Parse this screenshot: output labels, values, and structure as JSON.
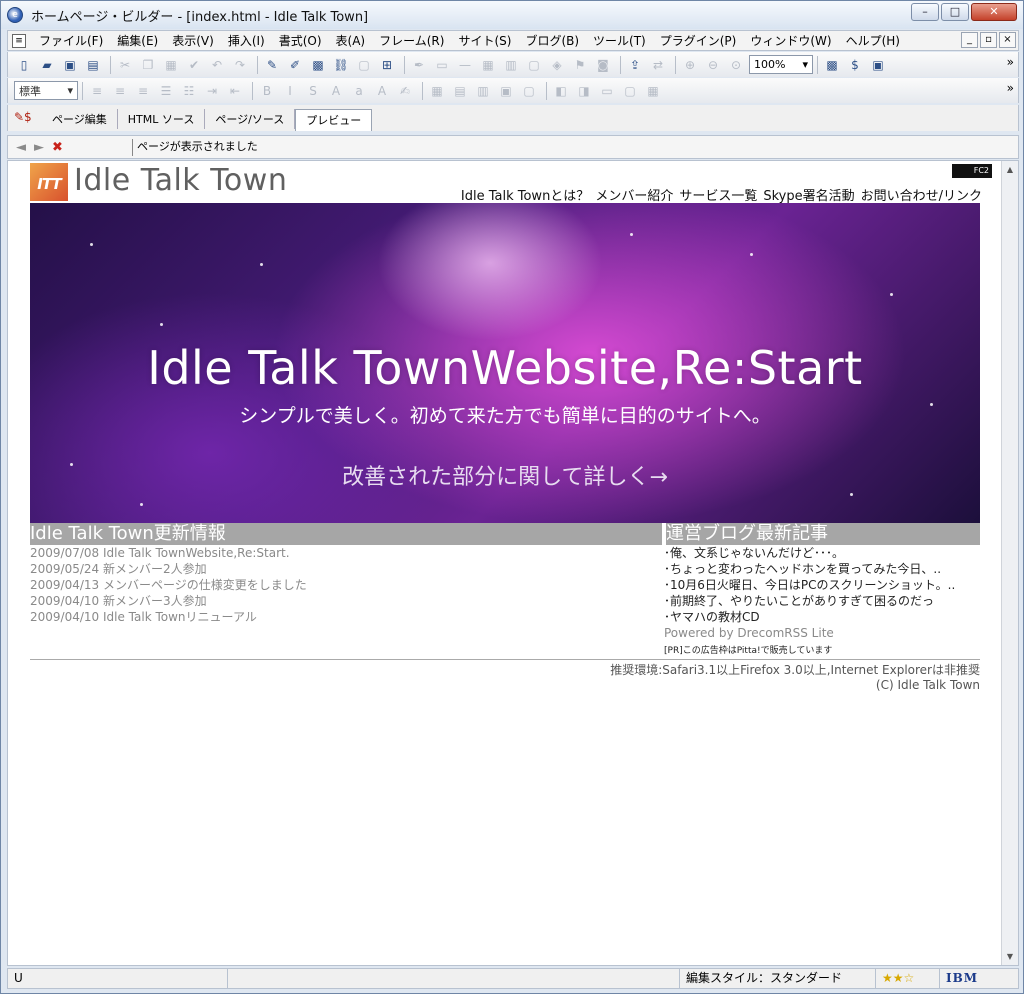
{
  "window": {
    "title": "ホームページ・ビルダー - [index.html - Idle Talk Town]",
    "buttons": {
      "minimize": "–",
      "maximize": "□",
      "close": "✕"
    }
  },
  "menubar": {
    "items": [
      "ファイル(F)",
      "編集(E)",
      "表示(V)",
      "挿入(I)",
      "書式(O)",
      "表(A)",
      "フレーム(R)",
      "サイト(S)",
      "ブログ(B)",
      "ツール(T)",
      "プラグイン(P)",
      "ウィンドウ(W)",
      "ヘルプ(H)"
    ],
    "mdi": {
      "minimize": "_",
      "restore": "▫",
      "close": "×"
    }
  },
  "toolbar": {
    "zoom": "100%",
    "style_select": "標準",
    "more": "»"
  },
  "tabs": {
    "items": [
      "ページ編集",
      "HTML ソース",
      "ページ/ソース",
      "プレビュー"
    ],
    "active_index": 3
  },
  "nav": {
    "back": "◄",
    "forward": "►",
    "stop": "✖",
    "status_message": "ページが表示されました"
  },
  "site": {
    "badge": "FC2",
    "logo_mark": "ITT",
    "logo_text": "Idle Talk Town",
    "nav": [
      "Idle Talk Townとは？",
      "メンバー紹介",
      "サービス一覧",
      "Skype署名活動",
      "お問い合わせ/リンク"
    ],
    "hero": {
      "title": "Idle Talk TownWebsite,Re:Start",
      "subtitle": "シンプルで美しく。初めて来た方でも簡単に目的のサイトへ。",
      "link": "改善された部分に関して詳しく→"
    },
    "news": {
      "heading": "Idle Talk Town更新情報",
      "items": [
        "2009/07/08 Idle Talk TownWebsite,Re:Start.",
        "2009/05/24 新メンバー2人参加",
        "2009/04/13 メンバーページの仕様変更をしました",
        "2009/04/10 新メンバー3人参加",
        "2009/04/10 Idle Talk Townリニューアル"
      ]
    },
    "blog": {
      "heading": "運営ブログ最新記事",
      "items": [
        "･俺、文系じゃないんだけど･･･。",
        "･ちょっと変わったヘッドホンを買ってみた今日、..",
        "･10月6日火曜日、今日はPCのスクリーンショット。..",
        "･前期終了、やりたいことがありすぎて困るのだっ",
        "･ヤマハの教材CD"
      ],
      "powered": "Powered by DrecomRSS Lite",
      "pr": "[PR]この広告枠はPitta!で販売しています"
    },
    "footer": {
      "env": "推奨環境:Safari3.1以上Firefox 3.0以上,Internet Explorerは非推奨",
      "copyright": "(C) Idle Talk Town"
    }
  },
  "statusbar": {
    "mode": "U",
    "edit_style": "編集スタイル：スタンダード",
    "rating": "★★☆",
    "brand": "IBM"
  },
  "colors": {
    "heading_bar": "#a6a6a6",
    "hero_accent": "#e050dc",
    "logo_orange": "#e06a34"
  }
}
